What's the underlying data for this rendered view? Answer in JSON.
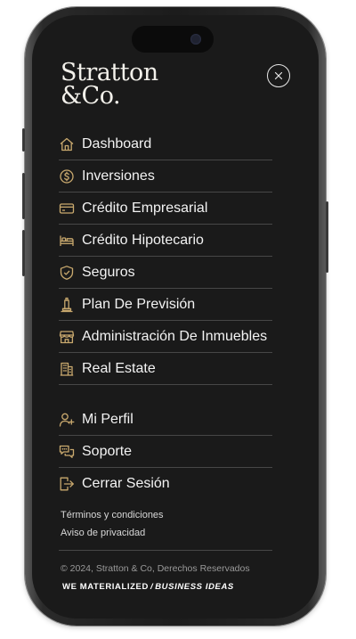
{
  "brand": {
    "line1": "Stratton",
    "line2": "&Co."
  },
  "accent_color": "#c9a96e",
  "menu": {
    "items": [
      {
        "label": "Dashboard",
        "icon": "home-icon"
      },
      {
        "label": "Inversiones",
        "icon": "dollar-coin-icon"
      },
      {
        "label": "Crédito Empresarial",
        "icon": "credit-card-icon"
      },
      {
        "label": "Crédito Hipotecario",
        "icon": "bed-icon"
      },
      {
        "label": "Seguros",
        "icon": "shield-check-icon"
      },
      {
        "label": "Plan De Previsión",
        "icon": "monument-icon"
      },
      {
        "label": "Administración De Inmuebles",
        "icon": "storefront-icon"
      },
      {
        "label": "Real Estate",
        "icon": "building-icon"
      }
    ]
  },
  "user_menu": {
    "items": [
      {
        "label": "Mi Perfil",
        "icon": "user-add-icon"
      },
      {
        "label": "Soporte",
        "icon": "support-chat-icon"
      },
      {
        "label": "Cerrar Sesión",
        "icon": "logout-icon"
      }
    ]
  },
  "legal": {
    "terms": "Términos y condiciones",
    "privacy": "Aviso de privacidad"
  },
  "footer": {
    "copyright": "© 2024, Stratton & Co, Derechos Reservados",
    "tagline_part1": "WE MATERIALIZED",
    "tagline_slash": "/",
    "tagline_part2": "BUSINESS IDEAS"
  }
}
